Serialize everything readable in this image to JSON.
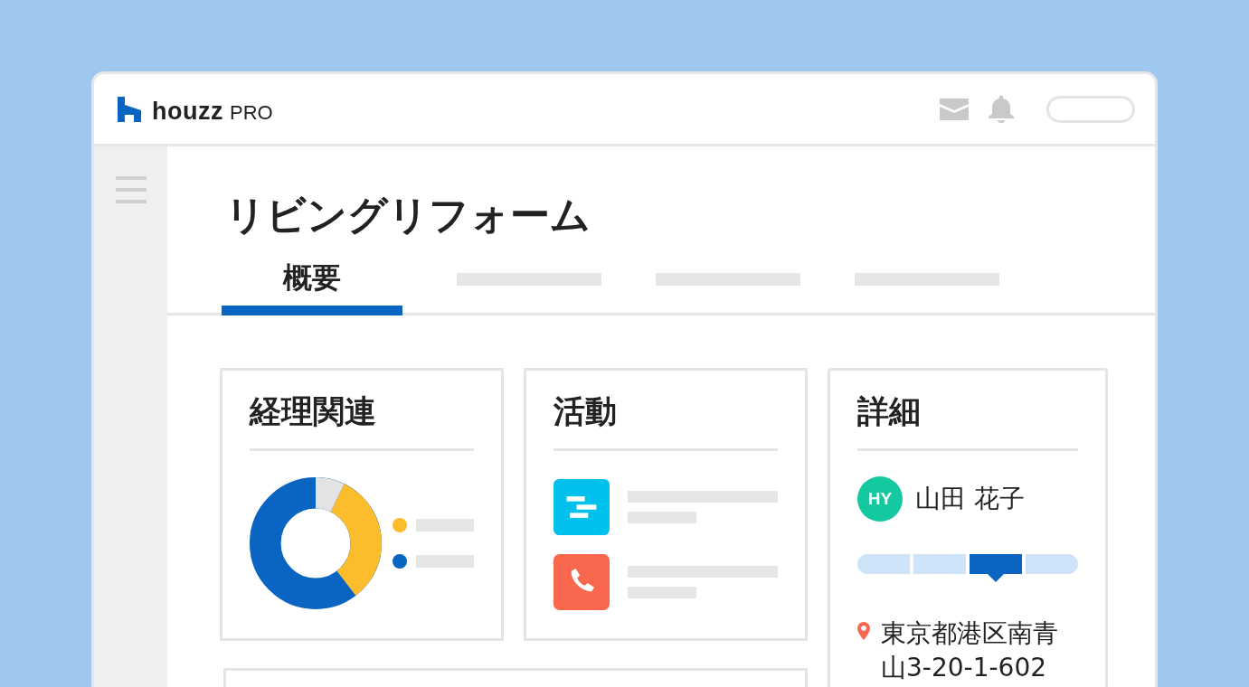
{
  "header": {
    "logo_word": "houzz",
    "logo_suffix": "PRO"
  },
  "page": {
    "title": "リビングリフォーム"
  },
  "tabs": [
    {
      "label": "概要",
      "selected": true
    },
    {
      "selected": false
    },
    {
      "selected": false
    },
    {
      "selected": false
    }
  ],
  "finance_card": {
    "title": "経理関連",
    "legend": [
      {
        "color": "#fbbd2c"
      },
      {
        "color": "#0a64c2"
      }
    ]
  },
  "activity_card": {
    "title": "活動",
    "items": [
      {
        "kind": "task"
      },
      {
        "kind": "call"
      }
    ]
  },
  "details_card": {
    "title": "詳細",
    "contact": {
      "initials": "HY",
      "name": "山田 花子"
    },
    "steps": [
      {
        "selected": false
      },
      {
        "selected": false
      },
      {
        "selected": true
      },
      {
        "selected": false
      }
    ],
    "address": "東京都港区南青山3-20-1-602"
  }
}
